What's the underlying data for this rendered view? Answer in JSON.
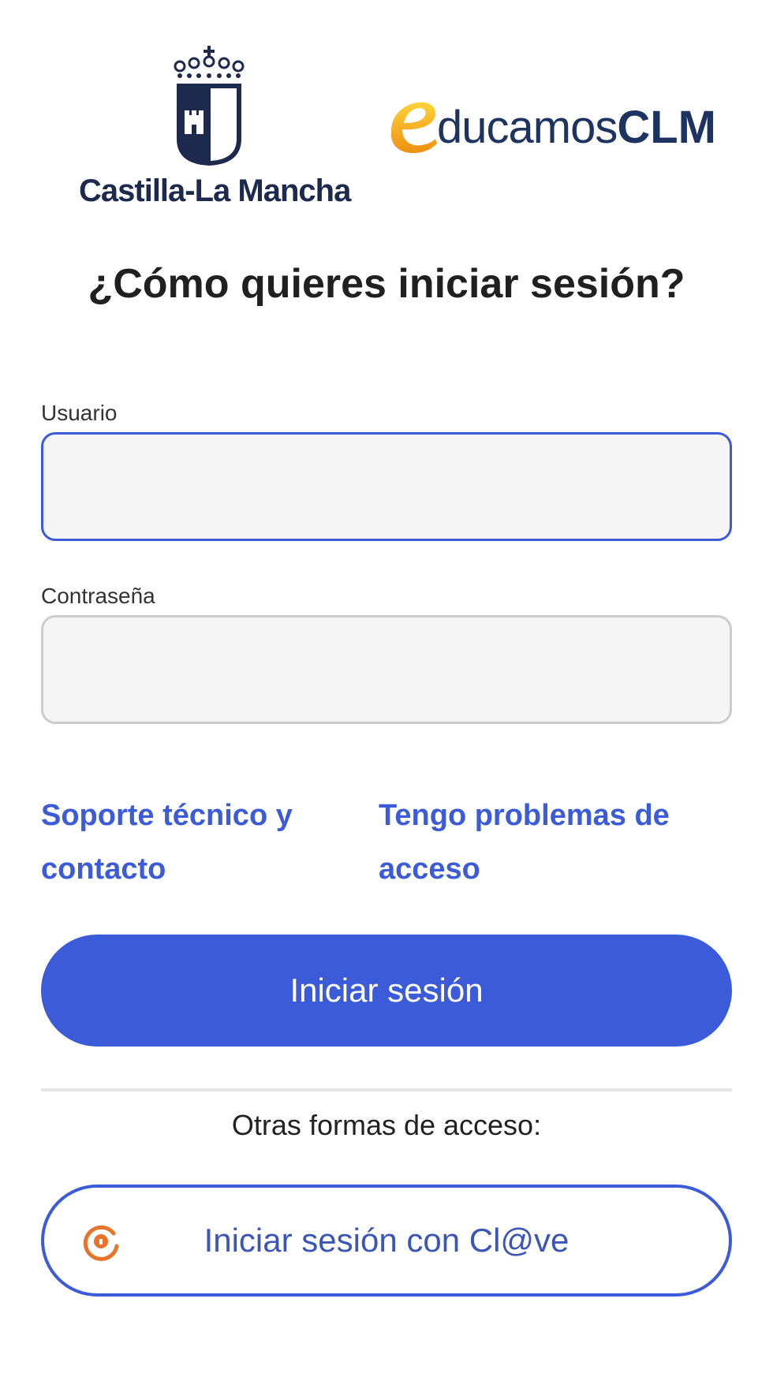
{
  "header": {
    "jccm_logo_text": "Castilla-La Mancha",
    "educamos_logo_text_light": "ducamos",
    "educamos_logo_text_bold": "CLM"
  },
  "title": "¿Cómo quieres iniciar sesión?",
  "form": {
    "user_label": "Usuario",
    "user_value": "",
    "password_label": "Contraseña",
    "password_value": ""
  },
  "links": {
    "support": "Soporte técnico y contacto",
    "access_problems": "Tengo problemas de acceso"
  },
  "login_button": "Iniciar sesión",
  "other_methods_label": "Otras formas de acceso:",
  "clave_button": "Iniciar sesión con Cl@ve",
  "icons": {
    "crest": "castilla-la-mancha-crest-icon",
    "educamos_e": "educamos-e-icon",
    "clave": "clave-icon"
  },
  "colors": {
    "accent": "#3b5bd9",
    "logo_navy": "#1d2a4e",
    "educamos_orange": "#f2a516",
    "clave_orange": "#e8742b",
    "input_background": "#f5f5f5"
  }
}
